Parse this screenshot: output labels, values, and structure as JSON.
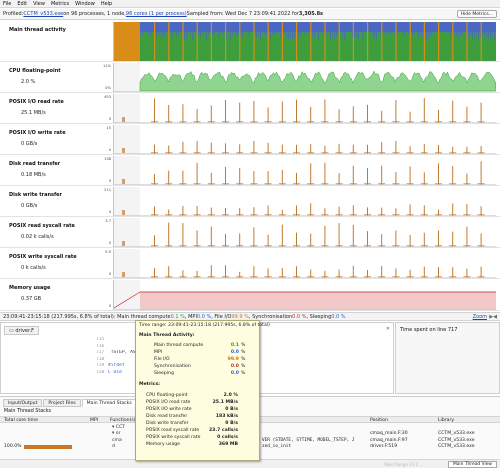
{
  "menu": [
    "File",
    "Edit",
    "View",
    "Metrics",
    "Window",
    "Help"
  ],
  "info": {
    "prefix": "Profiled: ",
    "exe_link": "CCTM_v533.exe",
    "on_text": " on 96 processes, 1 node, ",
    "cores_link": "96 cores (1 per process)",
    "sampled": " Sampled from: Wed Dec 7 23:09:41 2022 for ",
    "duration": "3,305.8s",
    "hide_button": "Hide Metrics..."
  },
  "metrics": [
    {
      "label": "Main thread activity",
      "value": "",
      "ticks": []
    },
    {
      "label": "CPU floating-point",
      "value": "2.0 %",
      "ticks": [
        "11%",
        "0%"
      ]
    },
    {
      "label": "POSIX I/O read rate",
      "value": "25.1 MB/s",
      "ticks": [
        "453",
        "0"
      ]
    },
    {
      "label": "POSIX I/O write rate",
      "value": "0 GB/s",
      "ticks": [
        "15",
        "0"
      ]
    },
    {
      "label": "Disk read transfer",
      "value": "0.18 MB/s",
      "ticks": [
        "138",
        "0"
      ]
    },
    {
      "label": "Disk write transfer",
      "value": "0 GB/s",
      "ticks": [
        "211",
        "0"
      ]
    },
    {
      "label": "POSIX read syscall rate",
      "value": "0.02 k calls/s",
      "ticks": [
        "3.7",
        "0"
      ]
    },
    {
      "label": "POSIX write syscall rate",
      "value": "0 k calls/s",
      "ticks": [
        "5.5",
        "0"
      ]
    },
    {
      "label": "Memory usage",
      "value": "0.37 GB",
      "ticks": [
        "",
        "0"
      ]
    }
  ],
  "colors": {
    "compute": "#3e9e3e",
    "io": "#d98c18",
    "mpi": "#4a64c8",
    "spike": "#c07a30",
    "memory": "#b8231f"
  },
  "timebar": {
    "range": "23:09:41-23:15:18 (217.995s, 6.8% of total): Main thread compute ",
    "compute": "0.1 %",
    "mpi_label": ", MPI ",
    "mpi": "0.0 %",
    "fileio_label": ", File I/O ",
    "fileio": "99.9 %",
    "sync_label": ", Synchronisation ",
    "sync": "0.0 %",
    "sleep_label": ", Sleeping ",
    "sleep": "0.0 %",
    "zoom": "Zoom"
  },
  "editor": {
    "tab": "driver.F",
    "lines": [
      {
        "n": "715",
        "text": ""
      },
      {
        "n": "716",
        "text": ""
      },
      {
        "n": "717",
        "text": "                                     TSTEP, ASTEP )"
      },
      {
        "n": "718",
        "text": ""
      },
      {
        "n": "719",
        "text": "#ifdef"
      },
      {
        "n": "720",
        "text": "C Use"
      }
    ]
  },
  "side": {
    "title": "Time spent on line 717"
  },
  "bottom": {
    "tabs": [
      "Input/Output",
      "Project Files",
      "Main Thread Stacks"
    ],
    "active_tab": 2,
    "subtitle": "Main Thread Stacks",
    "headers": {
      "total": "Total core time",
      "mpi": "MPI",
      "function": "Function(s)",
      "position": "Position",
      "library": "Library"
    },
    "rows": [
      {
        "total": "",
        "mpi": "",
        "fn": "▾ CCT",
        "position": "",
        "library": ""
      },
      {
        "total": "",
        "mpi": "",
        "fn": "  ▾ or",
        "position": "cmaq_main.F:30",
        "library": "CCTM_v533.exe"
      },
      {
        "total": "",
        "mpi": "",
        "fn": "    cma",
        "position": "cmaq_main.F:97",
        "library": "CCTM_v533.exe"
      },
      {
        "total": "100.0%",
        "mpi": "",
        "fn": "      d",
        "position": "driver.F:519",
        "library": "CCTM_v533.exe"
      }
    ],
    "code_fragments": [
      "VER (STDATE, STTIME, MODEL_TSTEP, J",
      "zed_io_init"
    ],
    "status_hint": "Main Range 23:1:..",
    "status_button": "Main Thread View"
  },
  "tooltip": {
    "header": "Time range: 23:09:41-23:15:18 (217.995s, 6.8% of total)",
    "activity_title": "Main Thread Activity:",
    "activity": [
      {
        "k": "Main thread compute",
        "v": "0.1",
        "u": "%"
      },
      {
        "k": "MPI",
        "v": "0.0",
        "u": "%"
      },
      {
        "k": "File I/O",
        "v": "99.9",
        "u": "%"
      },
      {
        "k": "Synchronisation",
        "v": "0.0",
        "u": "%"
      },
      {
        "k": "Sleeping",
        "v": "0.0",
        "u": "%"
      }
    ],
    "metrics_title": "Metrics:",
    "metrics": [
      {
        "k": "CPU floating-point",
        "v": "2.0 %"
      },
      {
        "k": "POSIX I/O read rate",
        "v": "25.1 MB/s"
      },
      {
        "k": "POSIX I/O write rate",
        "v": "0 B/s"
      },
      {
        "k": "Disk read transfer",
        "v": "183 kB/s"
      },
      {
        "k": "Disk write transfer",
        "v": "0 B/s"
      },
      {
        "k": "POSIX read syscall rate",
        "v": "23.7 calls/s"
      },
      {
        "k": "POSIX write syscall rate",
        "v": "0 calls/s"
      },
      {
        "k": "Memory usage",
        "v": "369 MB"
      }
    ]
  }
}
